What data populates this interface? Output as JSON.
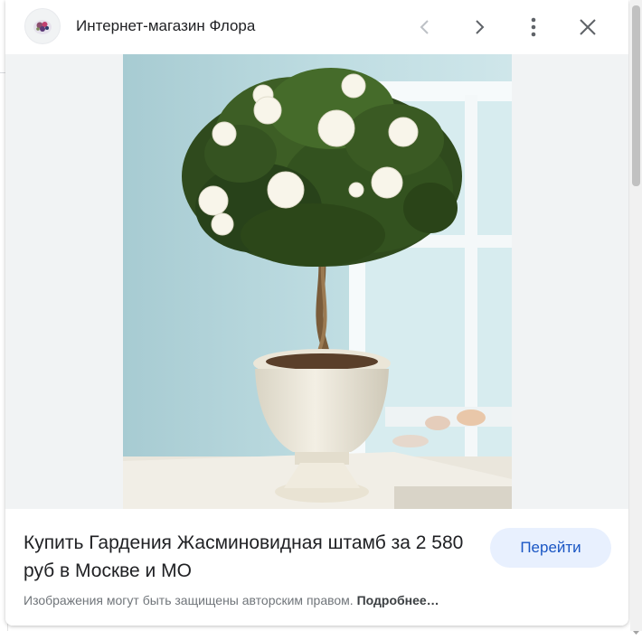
{
  "header": {
    "site_name": "Интернет-магазин Флора",
    "favicon_icon": "flower-logo-icon",
    "prev_icon": "chevron-left-icon",
    "next_icon": "chevron-right-icon",
    "more_icon": "more-vert-icon",
    "close_icon": "close-icon"
  },
  "image": {
    "alt": "Гардения Жасминовидная штамб"
  },
  "footer": {
    "title": "Купить Гардения Жасминовидная штамб за 2 580 руб в Москве и МО",
    "go_button": "Перейти",
    "copyright_text": "Изображения могут быть защищены авторским правом.",
    "more_link": "Подробнее…"
  },
  "colors": {
    "accent_button_bg": "#e8f0fe",
    "accent_button_text": "#1a56c4",
    "disabled_icon": "#bdc1c6",
    "icon": "#5f6368"
  }
}
